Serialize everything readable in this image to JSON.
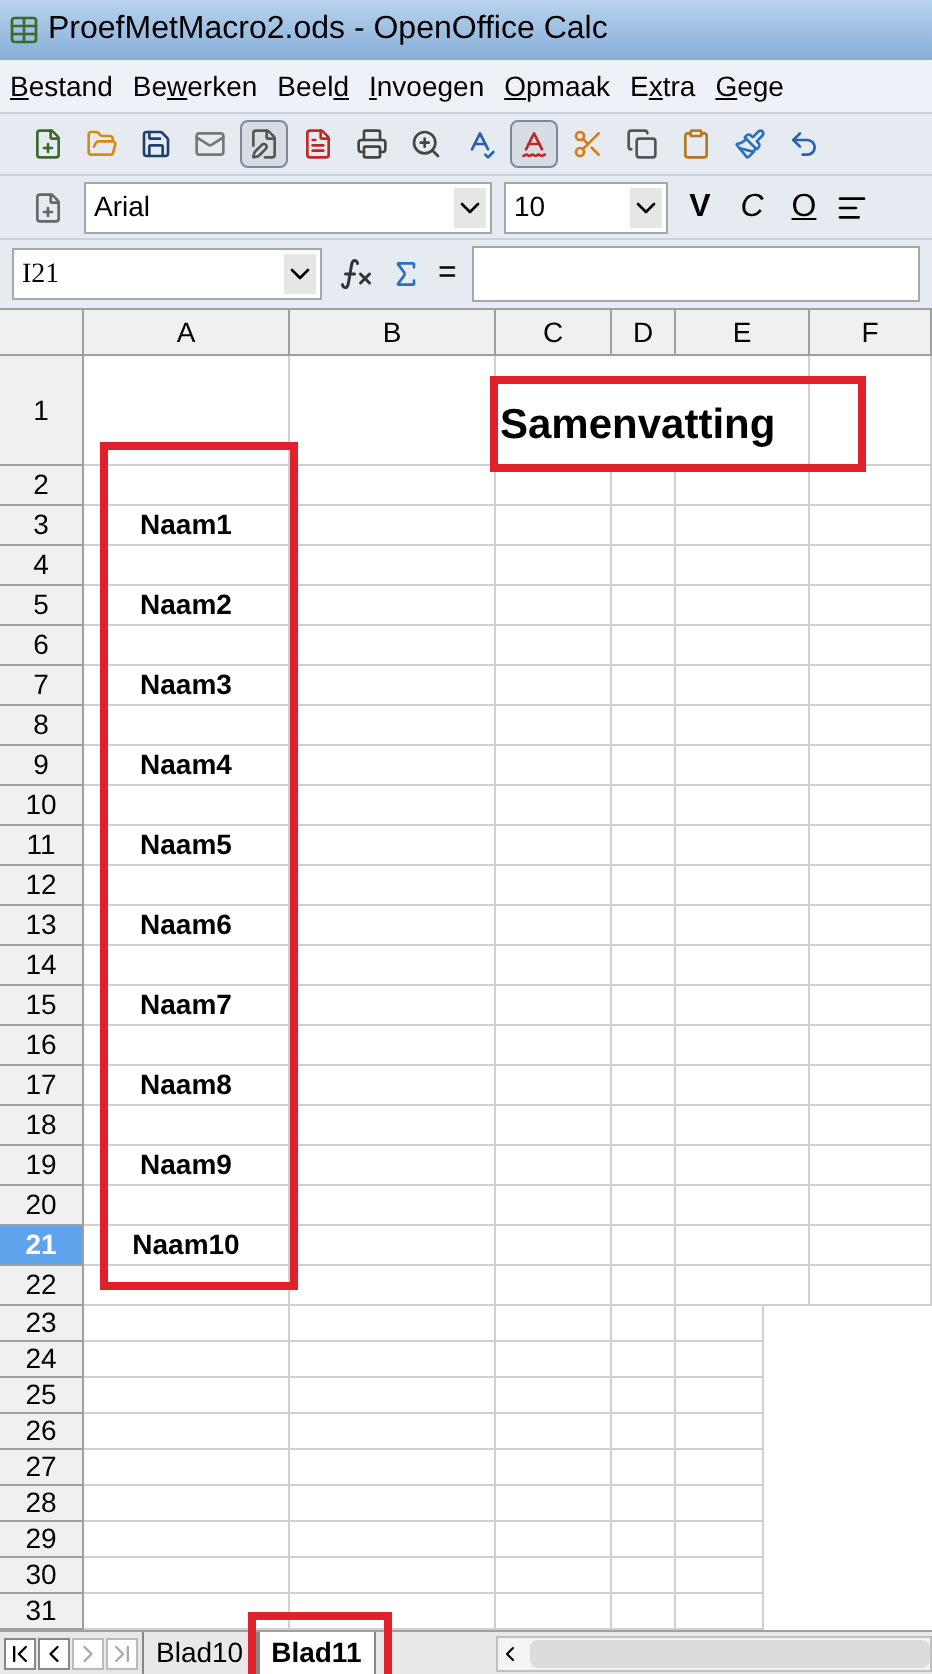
{
  "window": {
    "title": "ProefMetMacro2.ods - OpenOffice Calc"
  },
  "menu": [
    {
      "key": "B",
      "rest": "estand"
    },
    {
      "lead": "Be",
      "key": "w",
      "rest": "erken"
    },
    {
      "lead": "Beel",
      "key": "d"
    },
    {
      "key": "I",
      "rest": "nvoegen"
    },
    {
      "key": "O",
      "rest": "pmaak"
    },
    {
      "lead": "E",
      "key": "x",
      "rest": "tra"
    },
    {
      "key": "G",
      "rest": "ege"
    }
  ],
  "standard_toolbar": {
    "edit_mode_on": true,
    "autospell_on": true
  },
  "formatting_toolbar": {
    "font": "Arial",
    "size": "10",
    "bold": "V",
    "italic": "C",
    "underline": "O"
  },
  "formula_bar": {
    "name_box": "I21",
    "equals": "="
  },
  "columns": [
    "A",
    "B",
    "C",
    "D",
    "E",
    "F"
  ],
  "rows": [
    {
      "header": "1",
      "selected": false,
      "column_c": "Samenvatting"
    },
    {
      "header": "2",
      "selected": false
    },
    {
      "header": "3",
      "selected": false,
      "column_a": "Naam1"
    },
    {
      "header": "4",
      "selected": false
    },
    {
      "header": "5",
      "selected": false,
      "column_a": "Naam2"
    },
    {
      "header": "6",
      "selected": false
    },
    {
      "header": "7",
      "selected": false,
      "column_a": "Naam3"
    },
    {
      "header": "8",
      "selected": false
    },
    {
      "header": "9",
      "selected": false,
      "column_a": "Naam4"
    },
    {
      "header": "10",
      "selected": false
    },
    {
      "header": "11",
      "selected": false,
      "column_a": "Naam5"
    },
    {
      "header": "12",
      "selected": false
    },
    {
      "header": "13",
      "selected": false,
      "column_a": "Naam6"
    },
    {
      "header": "14",
      "selected": false
    },
    {
      "header": "15",
      "selected": false,
      "column_a": "Naam7"
    },
    {
      "header": "16",
      "selected": false
    },
    {
      "header": "17",
      "selected": false,
      "column_a": "Naam8"
    },
    {
      "header": "18",
      "selected": false
    },
    {
      "header": "19",
      "selected": false,
      "column_a": "Naam9"
    },
    {
      "header": "20",
      "selected": false
    },
    {
      "header": "21",
      "selected": true,
      "column_a": "Naam10"
    },
    {
      "header": "22",
      "selected": false
    }
  ],
  "lower_rows": [
    "23",
    "24",
    "25",
    "26",
    "27",
    "28",
    "29",
    "30",
    "31"
  ],
  "highlight_boxes": {
    "title_cell": true,
    "name_column": true,
    "active_tab": true
  },
  "sheet_tabs": [
    {
      "label": "Blad10",
      "selected": false
    },
    {
      "label": "Blad11",
      "selected": true
    }
  ]
}
